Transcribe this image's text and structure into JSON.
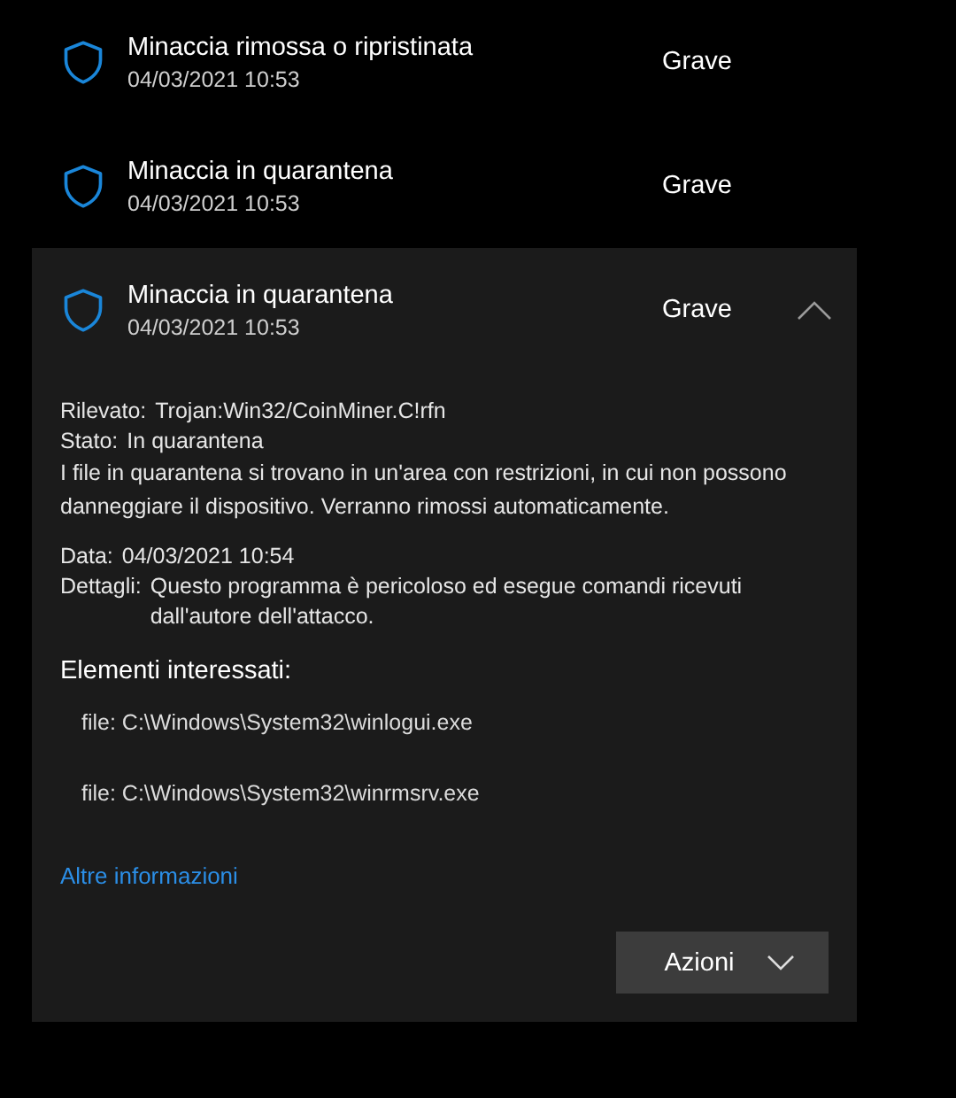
{
  "threats": [
    {
      "title": "Minaccia rimossa o ripristinata",
      "date": "04/03/2021 10:53",
      "severity": "Grave",
      "expanded": false
    },
    {
      "title": "Minaccia in quarantena",
      "date": "04/03/2021 10:53",
      "severity": "Grave",
      "expanded": false
    },
    {
      "title": "Minaccia in quarantena",
      "date": "04/03/2021 10:53",
      "severity": "Grave",
      "expanded": true,
      "details": {
        "fields_top": [
          {
            "label": "Rilevato:",
            "value": "Trojan:Win32/CoinMiner.C!rfn"
          },
          {
            "label": "Stato:",
            "value": "In quarantena"
          }
        ],
        "description": "I file in quarantena si trovano in un'area con restrizioni, in cui non possono danneggiare il dispositivo. Verranno rimossi automaticamente.",
        "fields_bottom": [
          {
            "label": "Data:",
            "value": "04/03/2021 10:54"
          },
          {
            "label": "Dettagli:",
            "value": "Questo programma è pericoloso ed esegue comandi ricevuti dall'autore dell'attacco."
          }
        ],
        "affected_heading": "Elementi interessati:",
        "affected_items": [
          "file: C:\\Windows\\System32\\winlogui.exe",
          "file: C:\\Windows\\System32\\winrmsrv.exe"
        ],
        "link": "Altre informazioni",
        "action_button": "Azioni"
      }
    }
  ]
}
